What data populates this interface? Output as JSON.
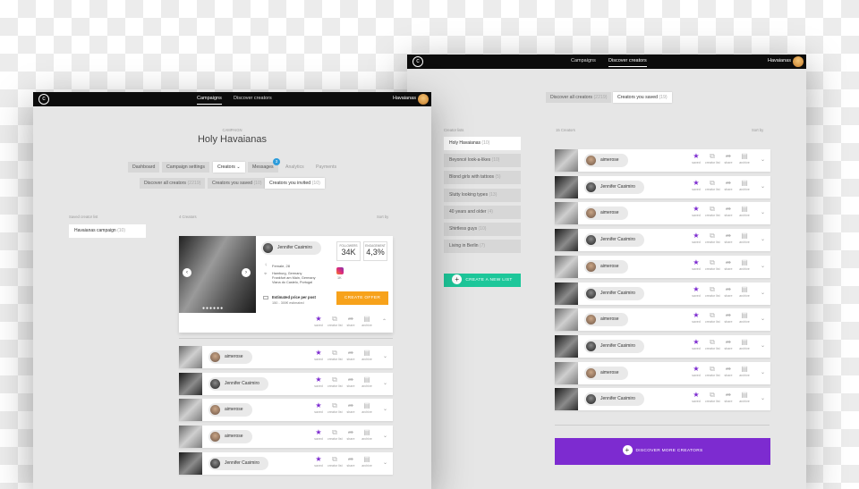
{
  "right_window": {
    "nav": [
      "Campaigns",
      "Discover creators"
    ],
    "user": "Havaianas",
    "tabs": [
      {
        "label": "Discover all creators",
        "count": "(2219)"
      },
      {
        "label": "Creators you saved",
        "count": "(19)"
      }
    ],
    "lists_label": "Creator lists",
    "creators_label": "15 Creators",
    "sort_label": "Sort by",
    "lists": [
      {
        "name": "Holy Havaianas",
        "count": "(10)"
      },
      {
        "name": "Beyoncé look-a-likes",
        "count": "(10)"
      },
      {
        "name": "Blond girls with tattoos",
        "count": "(5)"
      },
      {
        "name": "Slutty looking types",
        "count": "(13)"
      },
      {
        "name": "40 years and older",
        "count": "(4)"
      },
      {
        "name": "Shirtless guys",
        "count": "(10)"
      },
      {
        "name": "Living in Berlin",
        "count": "(7)"
      }
    ],
    "create_list": "CREATE A NEW LIST",
    "rows": [
      "aimerose",
      "Jennifer Casimiro",
      "aimerose",
      "Jennifer Casimiro",
      "aimerose",
      "Jennifer Casimiro",
      "aimerose",
      "Jennifer Casimiro",
      "aimerose",
      "Jennifer Casimiro"
    ],
    "discover_more": "DISCOVER MORE CREATORS"
  },
  "actions": {
    "saved": "saved",
    "list": "creator list",
    "share": "share",
    "archive": "archive"
  },
  "icons": {
    "saved": "star-icon",
    "list": "list-add-icon",
    "share": "share-icon",
    "archive": "archive-icon",
    "expand": "chevron-down-icon"
  },
  "left_window": {
    "nav": [
      "Campaigns",
      "Discover creators"
    ],
    "user": "Havaianas",
    "campaign_label": "CAMPAIGN",
    "campaign_title": "Holy Havaianas",
    "tabs": [
      "Dashboard",
      "Campaign settings",
      "Creators",
      "Messages",
      "Analytics",
      "Payments"
    ],
    "messages_badge": "3",
    "subtabs": [
      {
        "label": "Discover all creators",
        "count": "(2219)"
      },
      {
        "label": "Creators you saved",
        "count": "(10)"
      },
      {
        "label": "Creators you invited",
        "count": "(10)"
      }
    ],
    "list_label": "Saved creator list",
    "list_item": {
      "name": "Havaianas campaign",
      "count": "(10)"
    },
    "creators_label": "4 Creators",
    "sort_label": "Sort by",
    "card": {
      "name": "Jennifer Casimiro",
      "gender_age": "Female, 28",
      "location": "Hamburg, Germany\nFrankfurt am Main, Germany\nViana do Castelo, Portugal",
      "followers_label": "FOLLOWERS",
      "followers": "34K",
      "engagement_label": "ENGAGEMENT",
      "engagement": "4,3%",
      "platform_count": "1K",
      "price_label": "Estimated price per post",
      "price": "150 - 300€ estimated",
      "offer_button": "CREATE OFFER"
    },
    "rows": [
      "aimerose",
      "Jennifer Casimiro",
      "aimerose",
      "aimerose",
      "Jennifer Casimiro"
    ]
  },
  "colors": {
    "purple": "#7d2bd0",
    "green": "#1dc79a",
    "orange": "#f7a21b",
    "topbar": "#0c0c0c"
  }
}
